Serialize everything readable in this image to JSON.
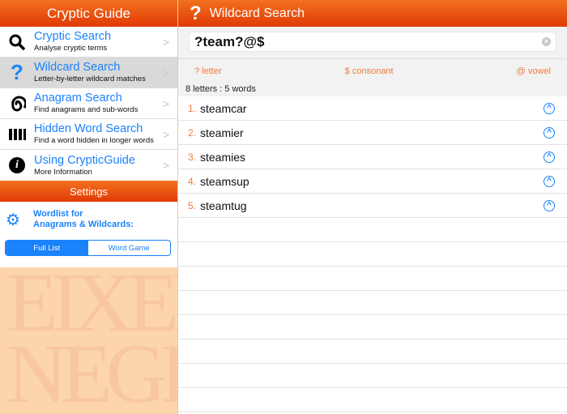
{
  "sidebar": {
    "title": "Cryptic Guide",
    "items": [
      {
        "title": "Cryptic Search",
        "subtitle": "Analyse cryptic terms",
        "icon": "search-icon"
      },
      {
        "title": "Wildcard Search",
        "subtitle": "Letter-by-letter wildcard matches",
        "icon": "question-icon"
      },
      {
        "title": "Anagram Search",
        "subtitle": "Find anagrams and sub-words",
        "icon": "spiral-icon"
      },
      {
        "title": "Hidden Word Search",
        "subtitle": "Find a word hidden in longer words",
        "icon": "bars-icon"
      },
      {
        "title": "Using CrypticGuide",
        "subtitle": "More Information",
        "icon": "info-icon"
      }
    ],
    "selected_index": 1,
    "settings_title": "Settings",
    "wordlist_line1": "Wordlist for",
    "wordlist_line2": "Anagrams & Wildcards:",
    "segments": [
      "Full List",
      "Word Game"
    ],
    "selected_segment": "Full List",
    "background_letters": "EIXEF\nNEGHI"
  },
  "main": {
    "title": "Wildcard Search",
    "query": "?team?@$",
    "legend": [
      "? letter",
      "$ consonant",
      "@ vowel"
    ],
    "count": "8 letters : 5 words",
    "results": [
      {
        "n": "1.",
        "word": "steamcar"
      },
      {
        "n": "2.",
        "word": "steamier"
      },
      {
        "n": "3.",
        "word": "steamies"
      },
      {
        "n": "4.",
        "word": "steamsup"
      },
      {
        "n": "5.",
        "word": "steamtug"
      }
    ]
  }
}
